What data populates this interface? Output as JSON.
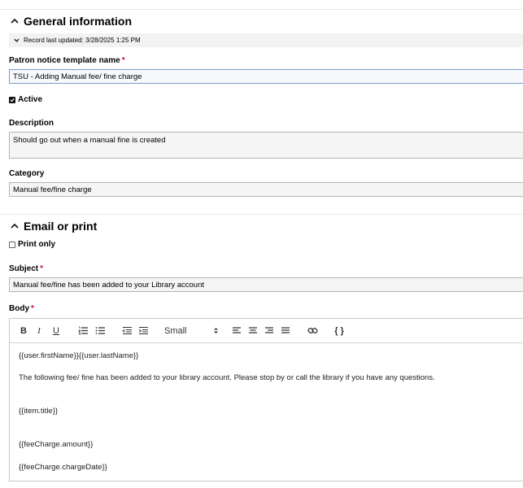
{
  "general": {
    "title": "General information",
    "record_updated": "Record last updated: 3/28/2025 1:25 PM",
    "template_name_label": "Patron notice template name",
    "required_mark": "*",
    "template_name_value": "TSU - Adding Manual fee/ fine charge",
    "active_label": "Active",
    "active_checked": true,
    "description_label": "Description",
    "description_value": "Should go out when a manual fine is created",
    "category_label": "Category",
    "category_value": "Manual fee/fine charge"
  },
  "email": {
    "title": "Email or print",
    "print_only_label": "Print only",
    "print_only_checked": false,
    "subject_label": "Subject",
    "subject_value": "Manual fee/fine has been added to your Library  account",
    "body_label": "Body",
    "toolbar": {
      "bold": "B",
      "italic": "I",
      "underline": "U",
      "size_value": "Small",
      "size_options_icon": "up-down-arrows-icon",
      "token_button": "{ }"
    },
    "body_lines": [
      "{{user.firstName}}{{user.lastName}}",
      "The following fee/ fine has been added to your library account. Please stop by or call the library if you have any questions.",
      "{{item.title}}",
      "{{feeCharge.amount}}",
      "{{feeCharge.chargeDate}}"
    ]
  },
  "colors": {
    "required": "#c8102e",
    "focus_border": "#7a9cc6",
    "field_bg": "#f5f5f5"
  }
}
